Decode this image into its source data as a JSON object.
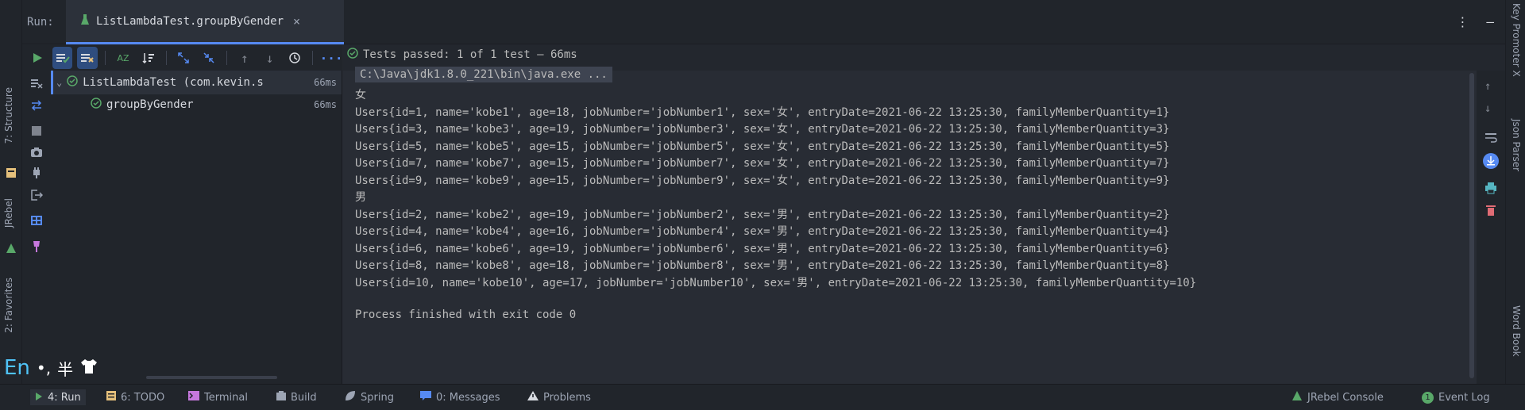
{
  "header": {
    "run_label": "Run:",
    "tab_title": "ListLambdaTest.groupByGender",
    "tab_close": "×"
  },
  "status": {
    "text": "Tests passed: 1 of 1 test – 66ms"
  },
  "tree": {
    "root": {
      "label": "ListLambdaTest (com.kevin.s",
      "duration": "66ms"
    },
    "child": {
      "label": "groupByGender",
      "duration": "66ms"
    }
  },
  "console": {
    "command": "C:\\Java\\jdk1.8.0_221\\bin\\java.exe ...",
    "lines": [
      "女",
      "Users{id=1, name='kobe1', age=18, jobNumber='jobNumber1', sex='女', entryDate=2021-06-22 13:25:30, familyMemberQuantity=1}",
      "Users{id=3, name='kobe3', age=19, jobNumber='jobNumber3', sex='女', entryDate=2021-06-22 13:25:30, familyMemberQuantity=3}",
      "Users{id=5, name='kobe5', age=15, jobNumber='jobNumber5', sex='女', entryDate=2021-06-22 13:25:30, familyMemberQuantity=5}",
      "Users{id=7, name='kobe7', age=15, jobNumber='jobNumber7', sex='女', entryDate=2021-06-22 13:25:30, familyMemberQuantity=7}",
      "Users{id=9, name='kobe9', age=15, jobNumber='jobNumber9', sex='女', entryDate=2021-06-22 13:25:30, familyMemberQuantity=9}",
      "男",
      "Users{id=2, name='kobe2', age=19, jobNumber='jobNumber2', sex='男', entryDate=2021-06-22 13:25:30, familyMemberQuantity=2}",
      "Users{id=4, name='kobe4', age=16, jobNumber='jobNumber4', sex='男', entryDate=2021-06-22 13:25:30, familyMemberQuantity=4}",
      "Users{id=6, name='kobe6', age=19, jobNumber='jobNumber6', sex='男', entryDate=2021-06-22 13:25:30, familyMemberQuantity=6}",
      "Users{id=8, name='kobe8', age=18, jobNumber='jobNumber8', sex='男', entryDate=2021-06-22 13:25:30, familyMemberQuantity=8}",
      "Users{id=10, name='kobe10', age=17, jobNumber='jobNumber10', sex='男', entryDate=2021-06-22 13:25:30, familyMemberQuantity=10}",
      "",
      "Process finished with exit code 0"
    ]
  },
  "left_strip": {
    "structure": "7: Structure",
    "jrebel": "JRebel",
    "favorites": "2: Favorites"
  },
  "right_strip": {
    "key_promoter": "Key Promoter X",
    "json_parser": "Json Parser",
    "word_book": "Word Book"
  },
  "bottom": {
    "run": "4: Run",
    "todo": "6: TODO",
    "terminal": "Terminal",
    "build": "Build",
    "spring": "Spring",
    "messages": "0: Messages",
    "problems": "Problems",
    "jrebel_console": "JRebel Console",
    "event_log": "Event Log",
    "event_count": "1"
  },
  "ime": {
    "lang": "En",
    "punct": "•,",
    "width": "半"
  },
  "colors": {
    "accent": "#568af2",
    "pass": "#59a869",
    "warn": "#e5c07b",
    "danger": "#e06c75"
  }
}
